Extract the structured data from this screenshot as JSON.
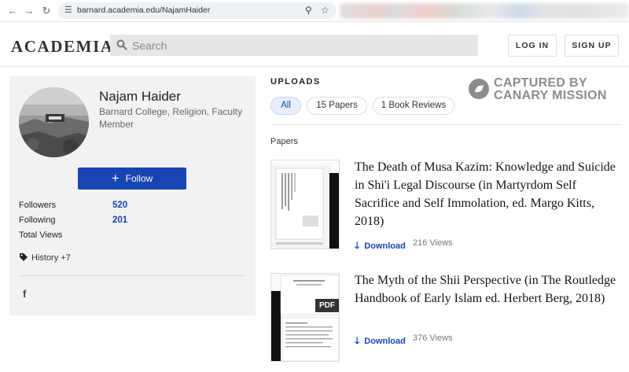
{
  "browser": {
    "url": "barnard.academia.edu/NajamHaider",
    "back_icon": "arrow-left-icon",
    "forward_icon": "arrow-right-icon",
    "reload_icon": "reload-icon"
  },
  "header": {
    "logo": "ACADEMIA",
    "search_placeholder": "Search",
    "login_label": "LOG IN",
    "signup_label": "SIGN UP"
  },
  "profile": {
    "name": "Najam Haider",
    "affiliation": "Barnard College, Religion, Faculty Member",
    "follow_label": "Follow",
    "stats": {
      "followers_label": "Followers",
      "followers_value": "520",
      "following_label": "Following",
      "following_value": "201",
      "total_views_label": "Total Views"
    },
    "tag": "History +7",
    "social_icon": "facebook-icon"
  },
  "uploads": {
    "heading": "UPLOADS",
    "tabs": [
      {
        "label": "All",
        "active": true
      },
      {
        "label": "15 Papers",
        "active": false
      },
      {
        "label": "1 Book Reviews",
        "active": false
      }
    ],
    "section_label": "Papers",
    "papers": [
      {
        "title": "The Death of Musa Kazim: Knowledge and Suicide in Shi'i Legal Discourse (in Martyrdom Self Sacrifice and Self Immolation, ed. Margo Kitts, 2018)",
        "download_label": "Download",
        "views": "216 Views"
      },
      {
        "title": "The Myth of the Shii Perspective (in The Routledge Handbook of Early Islam ed. Herbert Berg, 2018)",
        "download_label": "Download",
        "views": "376 Views",
        "badge": "PDF"
      }
    ]
  },
  "watermark": {
    "line1": "CAPTURED BY",
    "line2": "CANARY MISSION"
  },
  "colors": {
    "brand_blue": "#1745b3",
    "card_bg": "#f2f2f2",
    "watermark_gray": "#8c8c8c"
  }
}
